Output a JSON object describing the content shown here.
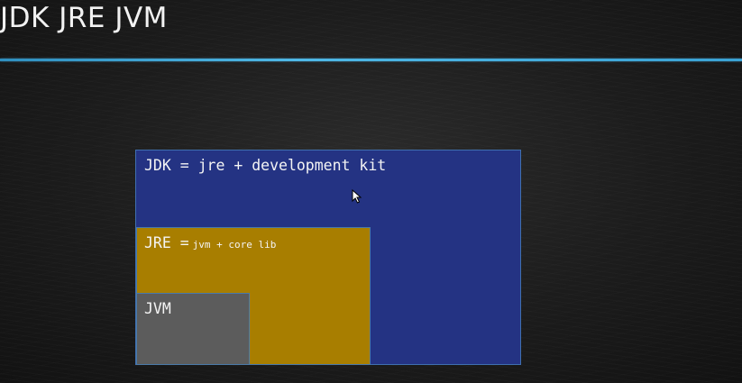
{
  "slide": {
    "title": "JDK JRE JVM"
  },
  "diagram": {
    "jdk": {
      "label": "JDK = jre + development kit",
      "color": "#243383"
    },
    "jre": {
      "name": "JRE =",
      "detail": "jvm + core lib",
      "color": "#a87e00"
    },
    "jvm": {
      "label": "JVM",
      "color": "#5c5c5c"
    }
  },
  "colors": {
    "title_rule": "#4fb8e6",
    "background": "#1c1c1c"
  },
  "icons": {
    "cursor": "mouse-pointer-icon"
  }
}
